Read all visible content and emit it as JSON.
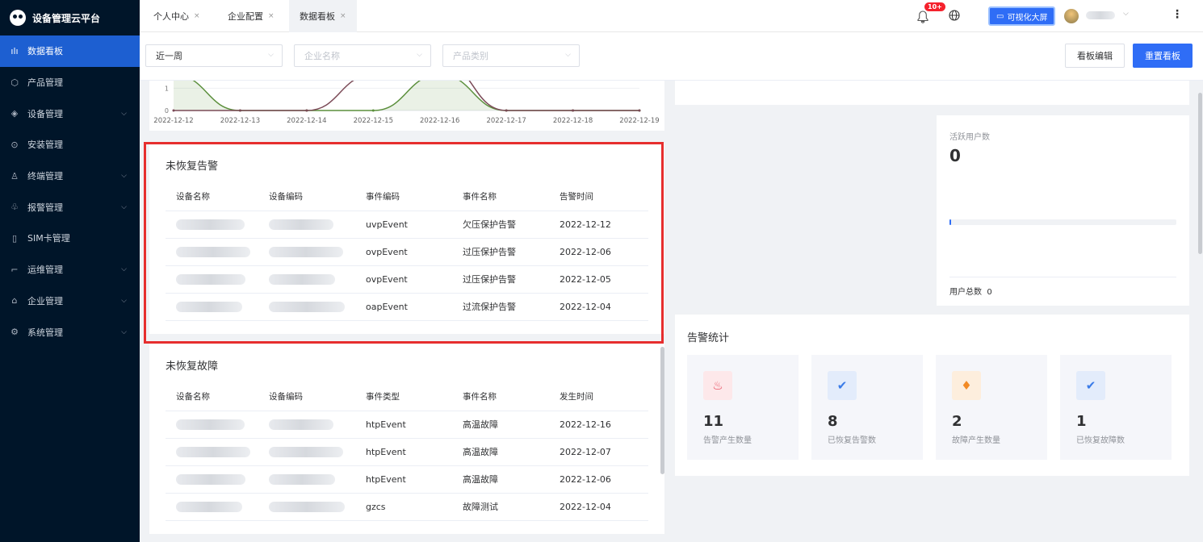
{
  "app": {
    "title": "设备管理云平台"
  },
  "sidebar": {
    "items": [
      {
        "label": "数据看板",
        "icon": "bar-chart-icon",
        "glyph": "ılı",
        "active": true,
        "chev": false
      },
      {
        "label": "产品管理",
        "icon": "cube-icon",
        "glyph": "⬡",
        "chev": false
      },
      {
        "label": "设备管理",
        "icon": "layers-icon",
        "glyph": "◈",
        "chev": true
      },
      {
        "label": "安装管理",
        "icon": "settings-circle-icon",
        "glyph": "⊙",
        "chev": false
      },
      {
        "label": "终端管理",
        "icon": "user-icon",
        "glyph": "♙",
        "chev": true
      },
      {
        "label": "报警管理",
        "icon": "alarm-icon",
        "glyph": "♧",
        "chev": true
      },
      {
        "label": "SIM卡管理",
        "icon": "sim-card-icon",
        "glyph": "▯",
        "chev": false
      },
      {
        "label": "运维管理",
        "icon": "tool-icon",
        "glyph": "⌐",
        "chev": true
      },
      {
        "label": "企业管理",
        "icon": "building-icon",
        "glyph": "⌂",
        "chev": true
      },
      {
        "label": "系统管理",
        "icon": "gear-icon",
        "glyph": "⚙",
        "chev": true
      }
    ]
  },
  "tabs": [
    {
      "label": "个人中心"
    },
    {
      "label": "企业配置"
    },
    {
      "label": "数据看板",
      "active": true
    }
  ],
  "header": {
    "notif_badge": "10+",
    "big_screen_label": "可视化大屏"
  },
  "filters": {
    "period": "近一周",
    "company_placeholder": "企业名称",
    "category_placeholder": "产品类别"
  },
  "buttons": {
    "edit": "看板编辑",
    "reset": "重置看板"
  },
  "chart_data": {
    "type": "line",
    "x": [
      "2022-12-12",
      "2022-12-13",
      "2022-12-14",
      "2022-12-15",
      "2022-12-16",
      "2022-12-17",
      "2022-12-18",
      "2022-12-19"
    ],
    "y_ticks": [
      "1",
      "0"
    ],
    "series": [
      {
        "color": "#5b8f3c",
        "values": [
          1.6,
          0,
          0,
          0,
          1.6,
          0,
          0,
          0
        ]
      },
      {
        "color": "#7b4a57",
        "values": [
          0,
          0,
          0,
          1.6,
          2.2,
          0,
          0,
          0
        ]
      }
    ],
    "ylim": [
      0,
      1.7
    ]
  },
  "alarms": {
    "title": "未恢复告警",
    "columns": [
      "设备名称",
      "设备编码",
      "事件编码",
      "事件名称",
      "告警时间"
    ],
    "rows": [
      {
        "code": "uvpEvent",
        "name": "欠压保护告警",
        "time": "2022-12-12"
      },
      {
        "code": "ovpEvent",
        "name": "过压保护告警",
        "time": "2022-12-06"
      },
      {
        "code": "ovpEvent",
        "name": "过压保护告警",
        "time": "2022-12-05"
      },
      {
        "code": "oapEvent",
        "name": "过流保护告警",
        "time": "2022-12-04"
      }
    ]
  },
  "faults": {
    "title": "未恢复故障",
    "columns": [
      "设备名称",
      "设备编码",
      "事件类型",
      "事件名称",
      "发生时间"
    ],
    "rows": [
      {
        "code": "htpEvent",
        "name": "高温故障",
        "time": "2022-12-16"
      },
      {
        "code": "htpEvent",
        "name": "高温故障",
        "time": "2022-12-07"
      },
      {
        "code": "htpEvent",
        "name": "高温故障",
        "time": "2022-12-06"
      },
      {
        "code": "gzcs",
        "name": "故障测试",
        "time": "2022-12-04"
      }
    ]
  },
  "active_users": {
    "title": "活跃用户数",
    "value": "0",
    "total_label": "用户总数",
    "total_value": "0",
    "progress": 0
  },
  "alarm_stats": {
    "title": "告警统计",
    "items": [
      {
        "value": "11",
        "label": "告警产生数量",
        "icon": "alarm-bell-icon",
        "bg": "#fde8ea",
        "fg": "#e8475a",
        "glyph": "♨"
      },
      {
        "value": "8",
        "label": "已恢复告警数",
        "icon": "verified-badge-icon",
        "bg": "#e3ecfb",
        "fg": "#3a7be8",
        "glyph": "✔"
      },
      {
        "value": "2",
        "label": "故障产生数量",
        "icon": "fire-icon",
        "bg": "#fdeedd",
        "fg": "#f28a25",
        "glyph": "♦"
      },
      {
        "value": "1",
        "label": "已恢复故障数",
        "icon": "verified-badge-icon",
        "bg": "#e3ecfb",
        "fg": "#3a7be8",
        "glyph": "✔"
      }
    ]
  }
}
